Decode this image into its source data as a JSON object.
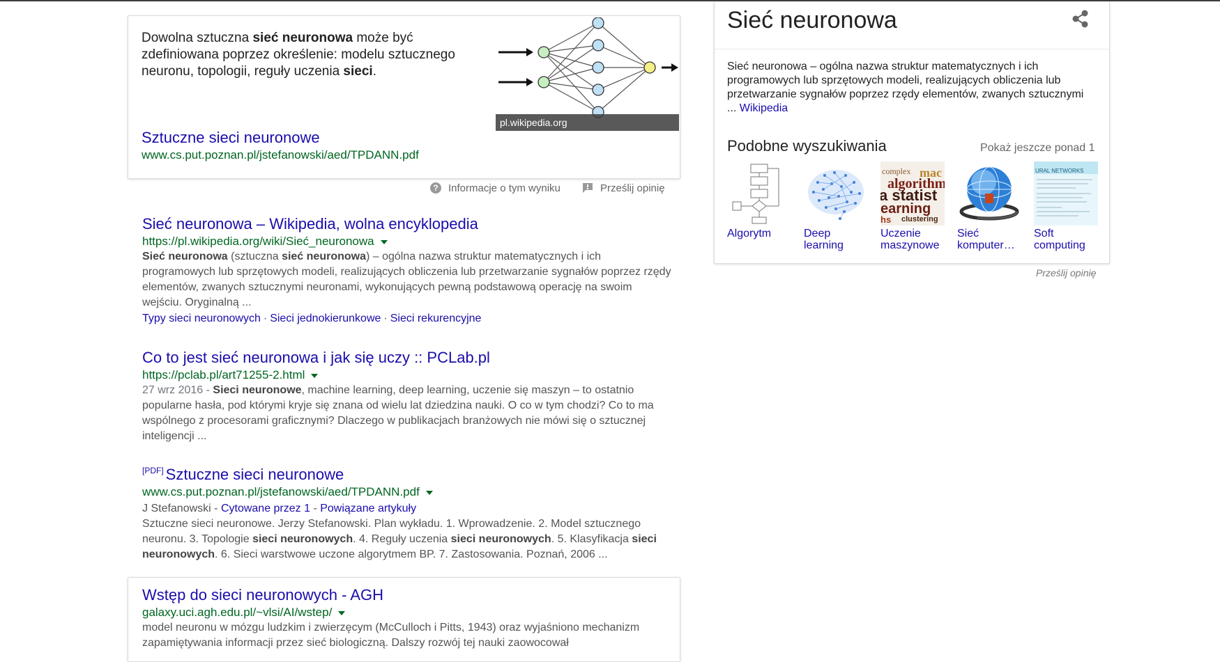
{
  "snippet": {
    "text_parts": [
      "Dowolna sztuczna ",
      "sieć neuronowa",
      " może być zdefiniowana poprzez określenie: modelu sztucznego neuronu, topologii, reguły uczenia ",
      "sieci",
      "."
    ],
    "image_caption": "pl.wikipedia.org",
    "title": "Sztuczne sieci neuronowe",
    "url": "www.cs.put.poznan.pl/jstefanowski/aed/TPDANN.pdf",
    "info_label": "Informacje o tym wyniku",
    "feedback_label": "Prześlij opinię"
  },
  "results": [
    {
      "title": "Sieć neuronowa – Wikipedia, wolna encyklopedia",
      "url": "https://pl.wikipedia.org/wiki/Sieć_neuronowa",
      "snippet_parts": [
        "Sieć neuronowa",
        " (sztuczna ",
        "sieć neuronowa",
        ") – ogólna nazwa struktur matematycznych i ich programowych lub sprzętowych modeli, realizujących obliczenia lub przetwarzanie sygnałów poprzez rzędy elementów, zwanych sztucznymi neuronami, wykonujących pewną podstawową operację na swoim wejściu. Oryginalną ..."
      ],
      "sitelinks": [
        "Typy sieci neuronowych",
        "Sieci jednokierunkowe",
        "Sieci rekurencyjne"
      ]
    },
    {
      "title": "Co to jest sieć neuronowa i jak się uczy :: PCLab.pl",
      "url": "https://pclab.pl/art71255-2.html",
      "date": "27 wrz 2016 - ",
      "snippet_parts": [
        "Sieci neuronowe",
        ", machine learning, deep learning, uczenie się maszyn – to ostatnio popularne hasła, pod którymi kryje się znana od wielu lat dziedzina nauki. O co w tym chodzi? Co to ma wspólnego z procesorami graficznymi? Dlaczego w publikacjach branżowych nie mówi się o sztucznej inteligencji ..."
      ]
    },
    {
      "badge": "[PDF]",
      "title": "Sztuczne sieci neuronowe",
      "url": "www.cs.put.poznan.pl/jstefanowski/aed/TPDANN.pdf",
      "author": "J Stefanowski - ",
      "cited_by": "Cytowane przez 1",
      "meta_sep": " - ",
      "related": "Powiązane artykuły",
      "snippet_parts": [
        "Sztuczne sieci neuronowe. Jerzy Stefanowski. Plan wykładu. 1. Wprowadzenie. 2. Model sztucznego neuronu. 3. Topologie ",
        "sieci neuronowych",
        ". 4. Reguły uczenia ",
        "sieci neuronowych",
        ". 5. Klasyfikacja ",
        "sieci neuronowych",
        ". 6. Sieci warstwowe uczone algorytmem BP. 7. Zastosowania. Poznań, 2006 ..."
      ]
    },
    {
      "title": "Wstęp do sieci neuronowych - AGH",
      "url": "galaxy.uci.agh.edu.pl/~vlsi/AI/wstep/",
      "snippet_parts": [
        "model neuronu w mózgu ludzkim i zwierzęcym (McCulloch i Pitts, 1943) oraz wyjaśniono mechanizm zapamiętywania informacji przez sieć biologiczną. Dalszy rozwój tej nauki zaowocował"
      ]
    }
  ],
  "knowledge_panel": {
    "title": "Sieć neuronowa",
    "description": "Sieć neuronowa – ogólna nazwa struktur matematycznych i ich programowych lub sprzętowych modeli, realizujących obliczenia lub przetwarzanie sygnałów poprzez rzędy elementów, zwanych sztucznymi",
    "desc_ellipsis": "... ",
    "desc_link": "Wikipedia",
    "similar_title": "Podobne wyszukiwania",
    "show_more": "Pokaż jeszcze ponad 1",
    "similar": [
      {
        "label": "Algorytm"
      },
      {
        "label": "Deep learning"
      },
      {
        "label": "Uczenie maszynowe"
      },
      {
        "label": "Sieć komputer…"
      },
      {
        "label": "Soft computing"
      }
    ],
    "thumb_texts": {
      "ml_words": [
        "complex",
        "mac",
        "algorithm",
        "a statist",
        "earning",
        "hs",
        "clustering"
      ],
      "soft_title": "URAL NETWORKS"
    },
    "feedback": "Prześlij opinię"
  }
}
